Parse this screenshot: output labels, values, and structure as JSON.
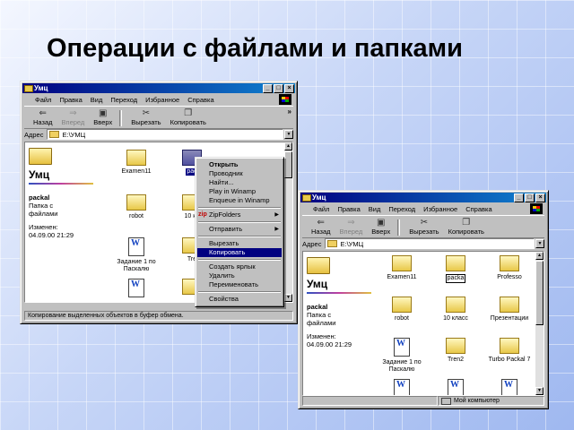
{
  "slide": {
    "title": "Операции с файлами и папками"
  },
  "window1": {
    "title": "Умц",
    "menu": [
      "Файл",
      "Правка",
      "Вид",
      "Переход",
      "Избранное",
      "Справка"
    ],
    "toolbar": {
      "back": "Назад",
      "forward": "Вперед",
      "up": "Вверх",
      "cut": "Вырезать",
      "copy": "Копировать"
    },
    "address_label": "Адрес",
    "address": "E:\\УМЦ",
    "webpanel": {
      "folder_title": "Умц",
      "selected_name": "packal",
      "selected_type_1": "Папка с",
      "selected_type_2": "файлами",
      "modified_label": "Изменен:",
      "modified_date": "04.09.00 21:29"
    },
    "items": [
      {
        "label": "Examen11",
        "kind": "folder"
      },
      {
        "label": "pac",
        "kind": "folder-selected"
      },
      {
        "label": "robot",
        "kind": "folder"
      },
      {
        "label": "10 кл",
        "kind": "folder"
      },
      {
        "label": "Задание 1 по",
        "label2": "Паскалю",
        "kind": "doc"
      },
      {
        "label": "Tre",
        "kind": "folder"
      },
      {
        "label": "",
        "kind": "doc"
      },
      {
        "label": "",
        "kind": "folder"
      }
    ],
    "status": "Копирование выделенных объектов в буфер обмена."
  },
  "context_menu": {
    "items": [
      {
        "label": "Открыть",
        "bold": true
      },
      {
        "label": "Проводник"
      },
      {
        "label": "Найти..."
      },
      {
        "label": "Play in Winamp"
      },
      {
        "label": "Enqueue in Winamp"
      },
      {
        "sep": true
      },
      {
        "label": "ZipFolders",
        "submenu": true,
        "zip": true
      },
      {
        "sep": true
      },
      {
        "label": "Отправить",
        "submenu": true
      },
      {
        "sep": true
      },
      {
        "label": "Вырезать"
      },
      {
        "label": "Копировать",
        "highlight": true
      },
      {
        "sep": true
      },
      {
        "label": "Создать ярлык"
      },
      {
        "label": "Удалить"
      },
      {
        "label": "Переименовать"
      },
      {
        "sep": true
      },
      {
        "label": "Свойства"
      }
    ]
  },
  "window2": {
    "title": "Умц",
    "menu": [
      "Файл",
      "Правка",
      "Вид",
      "Переход",
      "Избранное",
      "Справка"
    ],
    "toolbar": {
      "back": "Назад",
      "forward": "Вперед",
      "up": "Вверх",
      "cut": "Вырезать",
      "copy": "Копировать"
    },
    "address_label": "Адрес",
    "address": "E:\\УМЦ",
    "webpanel": {
      "folder_title": "Умц",
      "selected_name": "packal",
      "selected_type_1": "Папка с",
      "selected_type_2": "файлами",
      "modified_label": "Изменен:",
      "modified_date": "04.09.00 21:29"
    },
    "items": [
      {
        "label": "Examen11",
        "kind": "folder"
      },
      {
        "label": "packa",
        "kind": "folder-edit"
      },
      {
        "label": "Professo",
        "kind": "folder"
      },
      {
        "label": "robot",
        "kind": "folder"
      },
      {
        "label": "10 класс",
        "kind": "folder"
      },
      {
        "label": "Презентации",
        "kind": "folder"
      },
      {
        "label": "Задание 1 по",
        "label2": "Паскалю",
        "kind": "doc"
      },
      {
        "label": "Tren2",
        "kind": "folder"
      },
      {
        "label": "Turbo Packal 7",
        "kind": "folder"
      },
      {
        "label": "",
        "kind": "doc"
      },
      {
        "label": "",
        "kind": "doc"
      },
      {
        "label": "",
        "kind": "doc"
      }
    ],
    "status": "Мой компьютер"
  }
}
